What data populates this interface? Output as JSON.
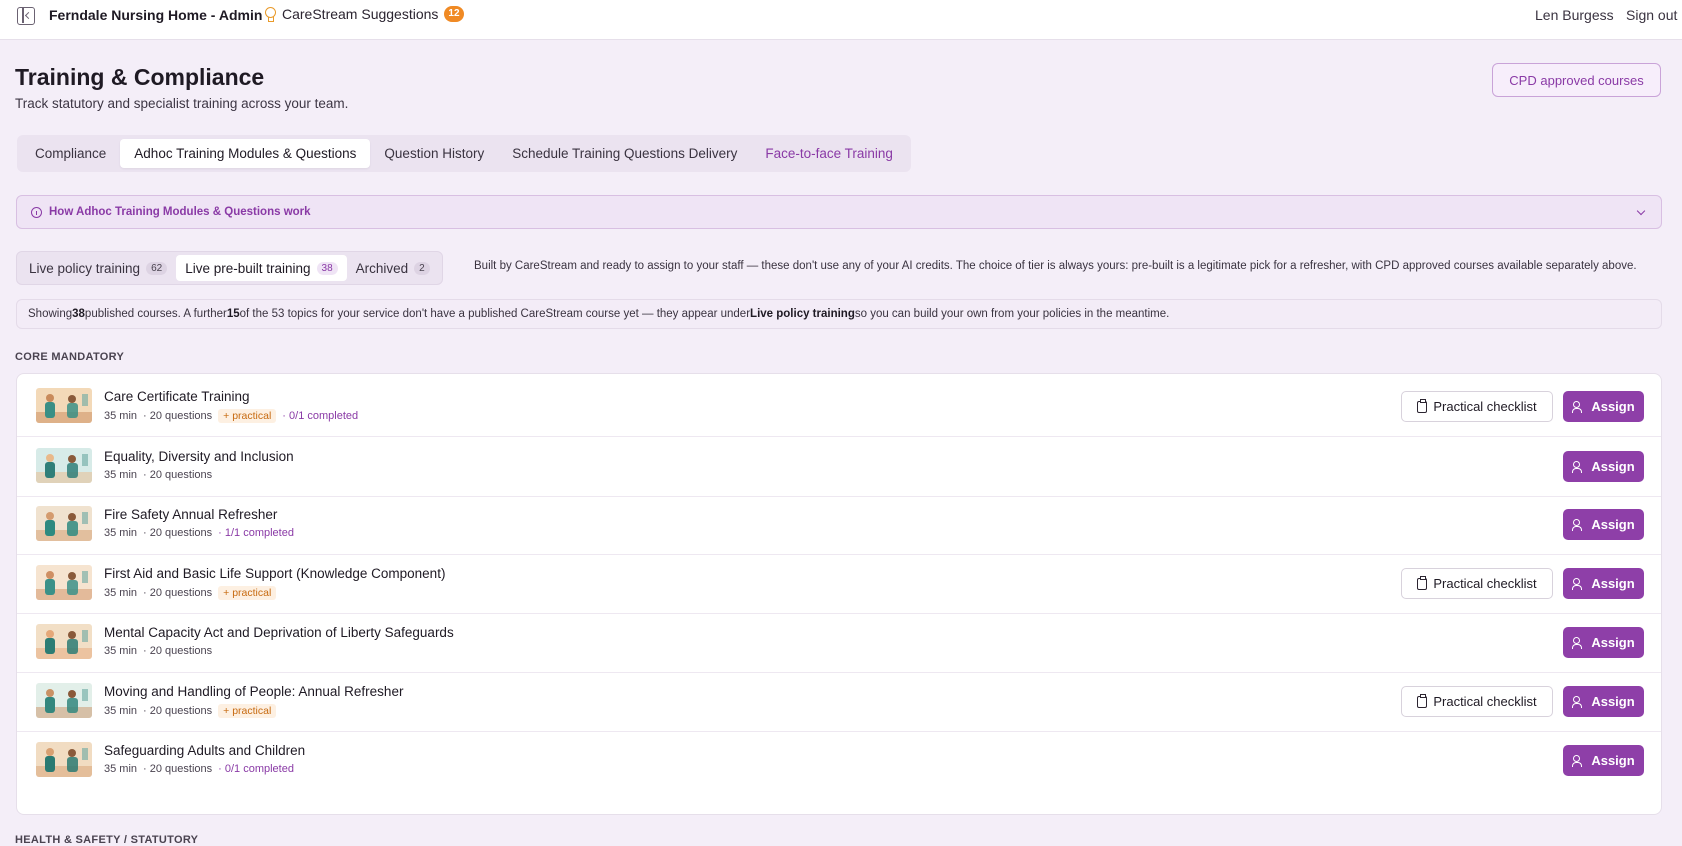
{
  "topbar": {
    "brand": "Ferndale Nursing Home - Admin",
    "suggestions_label": "CareStream Suggestions",
    "suggestions_count": "12",
    "user": "Len Burgess",
    "signout": "Sign out"
  },
  "header": {
    "title": "Training & Compliance",
    "subtitle": "Track statutory and specialist training across your team.",
    "cpd_button": "CPD approved courses"
  },
  "tabs": [
    {
      "label": "Compliance"
    },
    {
      "label": "Adhoc Training Modules & Questions"
    },
    {
      "label": "Question History"
    },
    {
      "label": "Schedule Training Questions Delivery"
    },
    {
      "label": "Face-to-face Training"
    }
  ],
  "howto": {
    "label": "How Adhoc Training Modules & Questions work"
  },
  "subtabs": [
    {
      "label": "Live policy training",
      "count": "62"
    },
    {
      "label": "Live pre-built training",
      "count": "38"
    },
    {
      "label": "Archived",
      "count": "2"
    }
  ],
  "blurb": "Built by CareStream and ready to assign to your staff — these don't use any of your AI credits. The choice of tier is always yours: pre-built is a legitimate pick for a refresher, with CPD approved courses available separately above.",
  "showing": {
    "p1": "Showing ",
    "published": "38",
    "p2": " published courses. A further ",
    "missing": "15",
    "p3": " of the 53 topics for your service don't have a published CareStream course yet — they appear under ",
    "link": "Live policy training",
    "p4": " so you can build your own from your policies in the meantime."
  },
  "sections": {
    "core": "CORE MANDATORY",
    "next": "HEALTH & SAFETY / STATUTORY"
  },
  "buttons": {
    "checklist": "Practical checklist",
    "assign": "Assign"
  },
  "courses": [
    {
      "title": "Care Certificate Training",
      "duration": "35 min",
      "questions": "· 20 questions",
      "practical": "+ practical",
      "completed": "· 0/1 completed"
    },
    {
      "title": "Equality, Diversity and Inclusion",
      "duration": "35 min",
      "questions": "· 20 questions",
      "practical": "",
      "completed": ""
    },
    {
      "title": "Fire Safety Annual Refresher",
      "duration": "35 min",
      "questions": "· 20 questions",
      "practical": "",
      "completed": "· 1/1 completed"
    },
    {
      "title": "First Aid and Basic Life Support (Knowledge Component)",
      "duration": "35 min",
      "questions": "· 20 questions",
      "practical": "+ practical",
      "completed": ""
    },
    {
      "title": "Mental Capacity Act and Deprivation of Liberty Safeguards",
      "duration": "35 min",
      "questions": "· 20 questions",
      "practical": "",
      "completed": ""
    },
    {
      "title": "Moving and Handling of People: Annual Refresher",
      "duration": "35 min",
      "questions": "· 20 questions",
      "practical": "+ practical",
      "completed": ""
    },
    {
      "title": "Safeguarding Adults and Children",
      "duration": "35 min",
      "questions": "· 20 questions",
      "practical": "",
      "completed": "· 0/1 completed"
    }
  ],
  "colors": {
    "accent": "#8e3fa8",
    "practical": "#c76a10",
    "background": "#f4eef8"
  }
}
